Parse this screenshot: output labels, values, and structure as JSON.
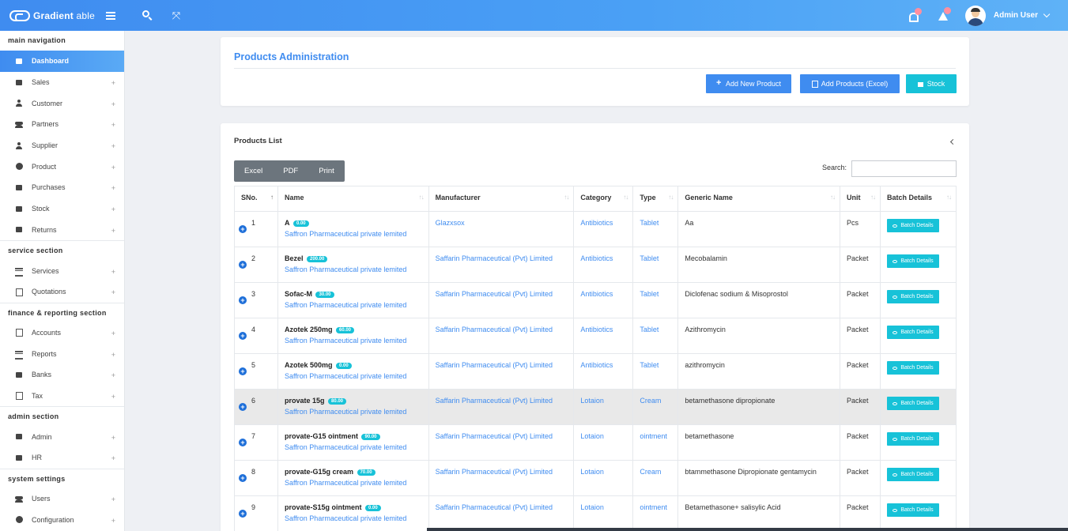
{
  "brand": {
    "name_bold": "Gradient",
    "name_light": " able"
  },
  "header": {
    "user_name": "Admin User"
  },
  "sidebar": {
    "sections": {
      "main": "main navigation",
      "service": "service section",
      "finance": "finance & reporting section",
      "admin": "admin section",
      "system": "system settings"
    },
    "items": {
      "dashboard": "Dashboard",
      "sales": "Sales",
      "customer": "Customer",
      "partners": "Partners",
      "supplier": "Supplier",
      "product": "Product",
      "purchases": "Purchases",
      "stock": "Stock",
      "returns": "Returns",
      "services": "Services",
      "quotations": "Quotations",
      "accounts": "Accounts",
      "reports": "Reports",
      "banks": "Banks",
      "tax": "Tax",
      "admin": "Admin",
      "hr": "HR",
      "users": "Users",
      "configuration": "Configuration"
    },
    "expand_glyph": "+"
  },
  "admin_card": {
    "title": "Products Administration",
    "add_new": "Add New Product",
    "add_excel": "Add Products (Excel)",
    "stock": "Stock"
  },
  "list_card": {
    "title": "Products List",
    "export": {
      "excel": "Excel",
      "pdf": "PDF",
      "print": "Print"
    },
    "search_label": "Search:",
    "search_value": "",
    "columns": {
      "sno": "SNo.",
      "name": "Name",
      "manufacturer": "Manufacturer",
      "category": "Category",
      "type": "Type",
      "generic": "Generic Name",
      "unit": "Unit",
      "batch": "Batch Details"
    },
    "batch_label": "Batch Details",
    "rows": [
      {
        "sno": "1",
        "name": "A",
        "price": "0.00",
        "company": "Saffron Pharmaceutical private lemited",
        "manufacturer": "Glazxsox",
        "category": "Antibiotics",
        "type": "Tablet",
        "generic": "Aa",
        "unit": "Pcs"
      },
      {
        "sno": "2",
        "name": "Bezel",
        "price": "200.00",
        "company": "Saffron Pharmaceutical private lemited",
        "manufacturer": "Saffarin Pharmaceutical (Pvt) Limited",
        "category": "Antibiotics",
        "type": "Tablet",
        "generic": "Mecobalamin",
        "unit": "Packet"
      },
      {
        "sno": "3",
        "name": "Sofac-M",
        "price": "30.00",
        "company": "Saffron Pharmaceutical private lemited",
        "manufacturer": "Saffarin Pharmaceutical (Pvt) Limited",
        "category": "Antibiotics",
        "type": "Tablet",
        "generic": "Diclofenac sodium & Misoprostol",
        "unit": "Packet"
      },
      {
        "sno": "4",
        "name": "Azotek 250mg",
        "price": "60.00",
        "company": "Saffron Pharmaceutical private lemited",
        "manufacturer": "Saffarin Pharmaceutical (Pvt) Limited",
        "category": "Antibiotics",
        "type": "Tablet",
        "generic": "Azithromycin",
        "unit": "Packet"
      },
      {
        "sno": "5",
        "name": "Azotek 500mg",
        "price": "0.00",
        "company": "Saffron Pharmaceutical private lemited",
        "manufacturer": "Saffarin Pharmaceutical (Pvt) Limited",
        "category": "Antibiotics",
        "type": "Tablet",
        "generic": "azithromycin",
        "unit": "Packet"
      },
      {
        "sno": "6",
        "name": "provate 15g",
        "price": "80.00",
        "company": "Saffron Pharmaceutical private lemited",
        "manufacturer": "Saffarin Pharmaceutical (Pvt) Limited",
        "category": "Lotaion",
        "type": "Cream",
        "generic": "betamethasone dipropionate",
        "unit": "Packet"
      },
      {
        "sno": "7",
        "name": "provate-G15 ointment",
        "price": "90.00",
        "company": "Saffron Pharmaceutical private lemited",
        "manufacturer": "Saffarin Pharmaceutical (Pvt) Limited",
        "category": "Lotaion",
        "type": "ointment",
        "generic": "betamethasone",
        "unit": "Packet"
      },
      {
        "sno": "8",
        "name": "provate-G15g cream",
        "price": "70.00",
        "company": "Saffron Pharmaceutical private lemited",
        "manufacturer": "Saffarin Pharmaceutical (Pvt) Limited",
        "category": "Lotaion",
        "type": "Cream",
        "generic": "btammethasone Dipropionate gentamycin",
        "unit": "Packet"
      },
      {
        "sno": "9",
        "name": "provate-S15g ointment",
        "price": "0.00",
        "company": "Saffron Pharmaceutical private lemited",
        "manufacturer": "Saffarin Pharmaceutical (Pvt) Limited",
        "category": "Lotaion",
        "type": "ointment",
        "generic": "Betamethasone+ salisylic Acid",
        "unit": "Packet"
      }
    ]
  },
  "colors": {
    "primary": "#3f8cf0",
    "accent": "#17c2d8",
    "export_group": "#6c757d"
  }
}
